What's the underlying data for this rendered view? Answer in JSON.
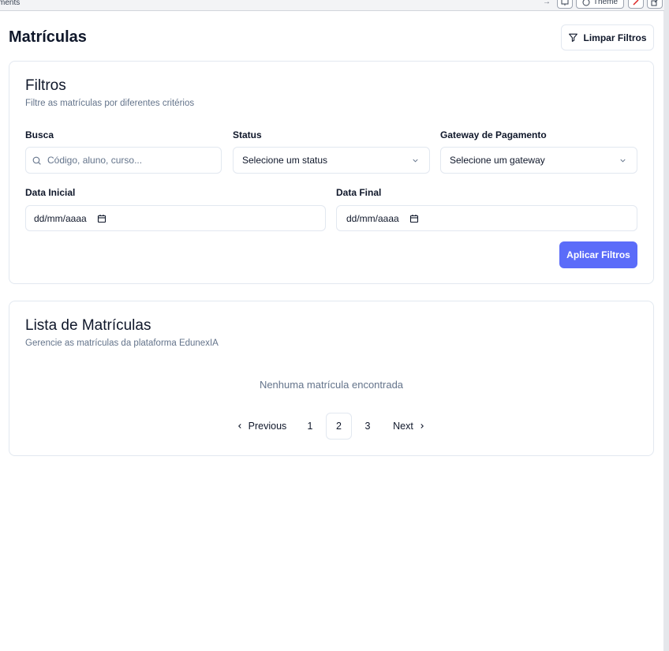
{
  "topbar": {
    "left_text": "ments",
    "theme_label": "Theme"
  },
  "header": {
    "title": "Matrículas",
    "clear_filters_label": "Limpar Filtros"
  },
  "filters_card": {
    "title": "Filtros",
    "subtitle": "Filtre as matrículas por diferentes critérios",
    "search": {
      "label": "Busca",
      "placeholder": "Código, aluno, curso..."
    },
    "status": {
      "label": "Status",
      "selected": "Selecione um status"
    },
    "gateway": {
      "label": "Gateway de Pagamento",
      "selected": "Selecione um gateway"
    },
    "start_date": {
      "label": "Data Inicial",
      "value": "dd/mm/aaaa"
    },
    "end_date": {
      "label": "Data Final",
      "value": "dd/mm/aaaa"
    },
    "apply_label": "Aplicar Filtros"
  },
  "list_card": {
    "title": "Lista de Matrículas",
    "subtitle": "Gerencie as matrículas da plataforma EdunexIA",
    "empty_text": "Nenhuma matrícula encontrada",
    "pagination": {
      "previous_label": "Previous",
      "next_label": "Next",
      "pages": [
        "1",
        "2",
        "3"
      ],
      "current_page": "2"
    }
  },
  "colors": {
    "primary": "#5b6cf9",
    "border": "#e2e8f0",
    "muted_text": "#64748b",
    "text": "#0f172a"
  }
}
